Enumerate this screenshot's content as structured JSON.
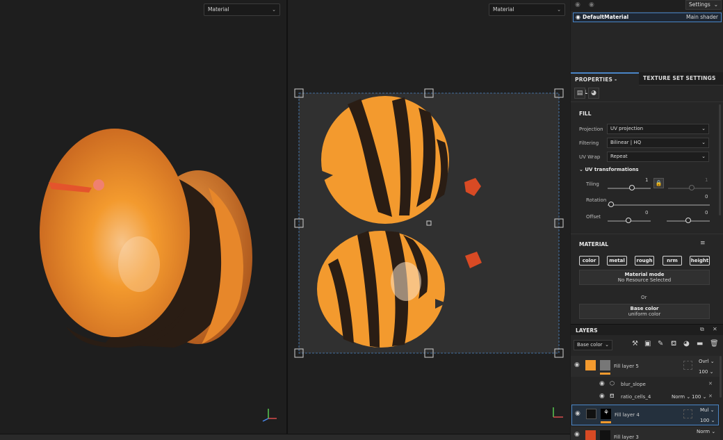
{
  "viewport_3d": {
    "select_value": "Material"
  },
  "viewport_2d": {
    "select_value": "Material"
  },
  "top": {
    "settings_label": "Settings",
    "texture_set": {
      "name": "DefaultMaterial",
      "shader": "Main shader"
    }
  },
  "tabs": [
    {
      "label": "PROPERTIES - FILL",
      "active": true
    },
    {
      "label": "TEXTURE SET SETTINGS",
      "active": false
    }
  ],
  "fill": {
    "title": "FILL",
    "projection_label": "Projection",
    "projection_value": "UV projection",
    "filtering_label": "Filtering",
    "filtering_value": "Bilinear | HQ",
    "uvwrap_label": "UV Wrap",
    "uvwrap_value": "Repeat",
    "uvtrans_title": "UV transformations",
    "tiling_label": "Tiling",
    "tiling_value": "1",
    "tiling_value2": "1",
    "rotation_label": "Rotation",
    "rotation_value": "0",
    "offset_label": "Offset",
    "offset_value1": "0",
    "offset_value2": "0"
  },
  "material": {
    "title": "MATERIAL",
    "channels": [
      "color",
      "metal",
      "rough",
      "nrm",
      "height"
    ],
    "mode_label": "Material mode",
    "mode_value": "No Resource Selected",
    "or_label": "Or",
    "base_label": "Base color",
    "base_value": "uniform color"
  },
  "layers": {
    "title": "LAYERS",
    "channel_select": "Base color",
    "items": [
      {
        "name": "Fill layer 5",
        "blend": "Ovrl",
        "opacity": "100"
      },
      {
        "name": "blur_slope"
      },
      {
        "name": "ratio_cells_4",
        "blend": "Norm",
        "opacity": "100"
      },
      {
        "name": "Fill layer 4",
        "blend": "Mul",
        "opacity": "100"
      },
      {
        "name": "Fill layer 3",
        "blend": "Norm"
      }
    ]
  },
  "colors": {
    "accent": "#4a86c8",
    "orange": "#f39a2e",
    "dark_stripe": "#2a1d14"
  }
}
